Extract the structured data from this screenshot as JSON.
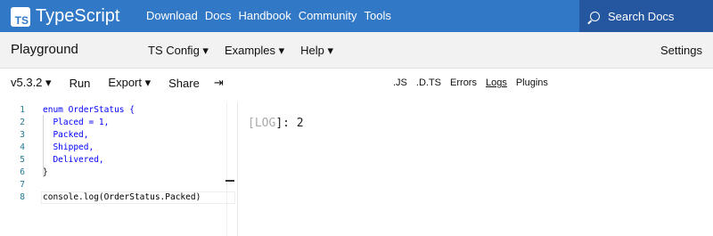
{
  "nav": {
    "logo_badge": "TS",
    "logo_text": "TypeScript",
    "links": [
      "Download",
      "Docs",
      "Handbook",
      "Community",
      "Tools"
    ],
    "search_label": "Search Docs"
  },
  "playground": {
    "title": "Playground",
    "menus": [
      "TS Config ▾",
      "Examples ▾",
      "Help ▾"
    ],
    "settings": "Settings"
  },
  "toolbar": {
    "version": "v5.3.2 ▾",
    "run": "Run",
    "export": "Export ▾",
    "share": "Share",
    "sidebar_toggle": "⇥",
    "tabs": [
      ".JS",
      ".D.TS",
      "Errors",
      "Logs",
      "Plugins"
    ],
    "active_tab": "Logs"
  },
  "editor": {
    "lines": [
      {
        "n": "1",
        "text": "enum OrderStatus {"
      },
      {
        "n": "2",
        "text": "  Placed = 1,"
      },
      {
        "n": "3",
        "text": "  Packed,"
      },
      {
        "n": "4",
        "text": "  Shipped,"
      },
      {
        "n": "5",
        "text": "  Delivered,"
      },
      {
        "n": "6",
        "text": "}"
      },
      {
        "n": "7",
        "text": ""
      },
      {
        "n": "8",
        "text": "console.log(OrderStatus.Packed)"
      }
    ]
  },
  "output": {
    "open_bracket": "[",
    "tag": "LOG",
    "close": "]: ",
    "value": "2"
  },
  "colors": {
    "brand": "#3178c6",
    "search_bg": "#24579f"
  }
}
